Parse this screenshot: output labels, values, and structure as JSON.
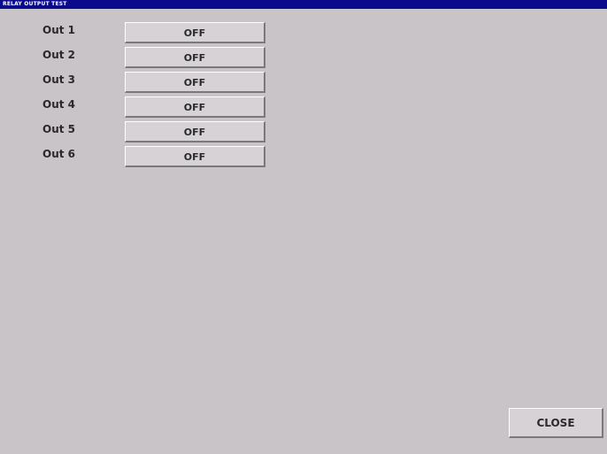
{
  "window": {
    "title": "RELAY OUTPUT TEST"
  },
  "outputs": [
    {
      "label": "Out 1",
      "state": "OFF"
    },
    {
      "label": "Out 2",
      "state": "OFF"
    },
    {
      "label": "Out 3",
      "state": "OFF"
    },
    {
      "label": "Out 4",
      "state": "OFF"
    },
    {
      "label": "Out 5",
      "state": "OFF"
    },
    {
      "label": "Out 6",
      "state": "OFF"
    }
  ],
  "footer": {
    "close_label": "CLOSE"
  },
  "colors": {
    "title_bar": "#0a0a8c",
    "background": "#c8c4c8",
    "button_face": "#d6d2d6"
  }
}
